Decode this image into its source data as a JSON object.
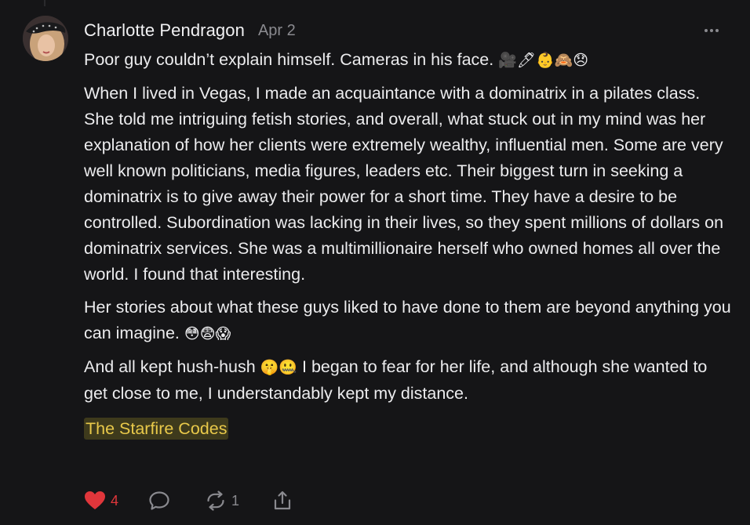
{
  "post": {
    "author": "Charlotte Pendragon",
    "date": "Apr 2",
    "intro_text": "Poor guy couldn’t explain himself. Cameras in his face.",
    "intro_emoji": "🎥🖊👶🙈😞",
    "paragraph1": "When I lived in Vegas, I made an acquaintance with a dominatrix in a pilates class. She told me intriguing fetish stories, and overall, what stuck out in my mind was her explanation of how her clients were extremely wealthy, influential men. Some are very well known politicians, media figures, leaders etc. Their biggest turn in seeking a dominatrix is to give away their power for a short time. They have a desire to be controlled. Subordination was lacking in their lives, so they spent millions of dollars on dominatrix services. She was a multimillionaire herself who owned homes all over the world. I found that interesting.",
    "paragraph2_text": "Her stories about what these guys liked to have done to them are beyond anything you can imagine.",
    "paragraph2_emoji": "😳😨😱",
    "paragraph3_start": "And all kept hush-hush",
    "paragraph3_emoji": "🤫🤐",
    "paragraph3_end": "I began to fear for her life, and although she wanted to get close to me, I understandably kept my distance.",
    "link_label": "The Starfire Codes"
  },
  "actions": {
    "like_count": "4",
    "repost_count": "1"
  },
  "icons": {
    "like": "heart-icon",
    "comment": "comment-icon",
    "repost": "repost-icon",
    "share": "share-icon",
    "more": "more-icon"
  },
  "colors": {
    "background": "#151517",
    "text": "#ececee",
    "muted": "#8a8a8f",
    "like": "#e0363b",
    "link_text": "#e9c94a",
    "link_bg": "#3e3a1c"
  }
}
